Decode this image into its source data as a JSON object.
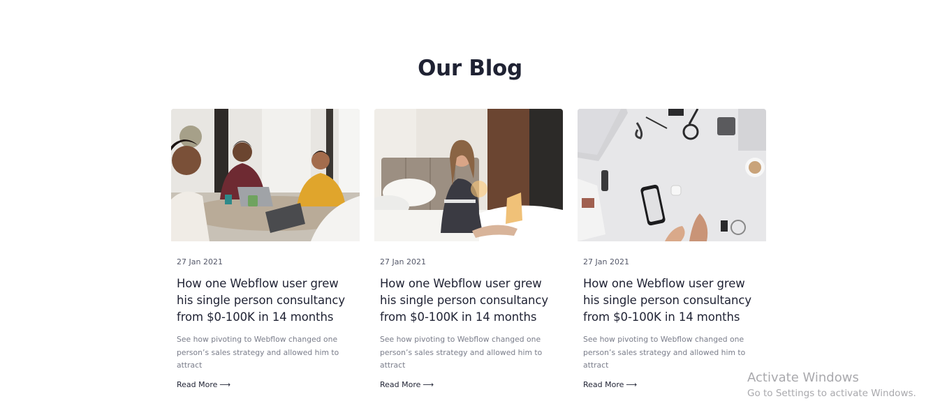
{
  "section": {
    "title": "Our Blog"
  },
  "posts": [
    {
      "image": "team-meeting-photo",
      "date": "27 Jan 2021",
      "title": "How one Webflow user grew his single person consultancy from $0-100K in 14 months",
      "excerpt": "See how pivoting to Webflow changed one person’s sales strategy and allowed him to attract",
      "read_more": "Read More",
      "arrow": "⟶"
    },
    {
      "image": "woman-laptop-bed-photo",
      "date": "27 Jan 2021",
      "title": "How one Webflow user grew his single person consultancy from $0-100K in 14 months",
      "excerpt": "See how pivoting to Webflow changed one person’s sales strategy and allowed him to attract",
      "read_more": "Read More",
      "arrow": "⟶"
    },
    {
      "image": "desk-flatlay-photo",
      "date": "27 Jan 2021",
      "title": "How one Webflow user grew his single person consultancy from $0-100K in 14 months",
      "excerpt": "See how pivoting to Webflow changed one person’s sales strategy and allowed him to attract",
      "read_more": "Read More",
      "arrow": "⟶"
    }
  ],
  "watermark": {
    "title": "Activate Windows",
    "subtitle": "Go to Settings to activate Windows."
  }
}
